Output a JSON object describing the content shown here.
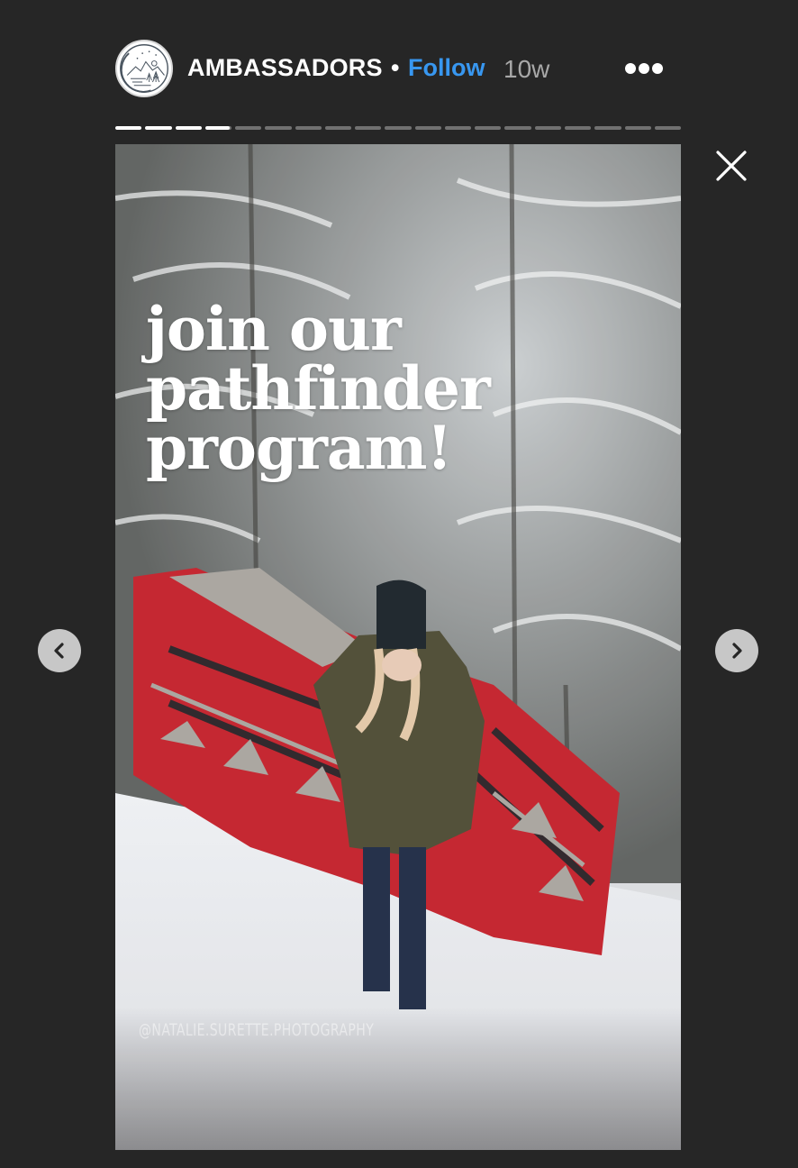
{
  "header": {
    "username": "AMBASSADORS",
    "separator": "•",
    "follow_label": "Follow",
    "timestamp": "10w",
    "avatar_icon": "mountain-moon-logo-icon",
    "more_icon": "more-options-icon"
  },
  "progress": {
    "total_segments": 19,
    "completed_segments": 3,
    "current_segment_index": 3,
    "current_segment_fraction": 0.92
  },
  "story": {
    "headline_lines": [
      "join our",
      "pathfinder",
      "program!"
    ],
    "photo_credit": "@NATALIE.SURETTE.PHOTOGRAPHY",
    "image_description": "Woman in green parka and beanie holding red patterned blanket in snowy forest"
  },
  "controls": {
    "close_icon": "close-icon",
    "prev_icon": "chevron-left-icon",
    "next_icon": "chevron-right-icon"
  },
  "colors": {
    "background": "#262626",
    "follow": "#3897f0",
    "timestamp": "#a8a8a8",
    "nav_button": "#c7c7c7"
  }
}
